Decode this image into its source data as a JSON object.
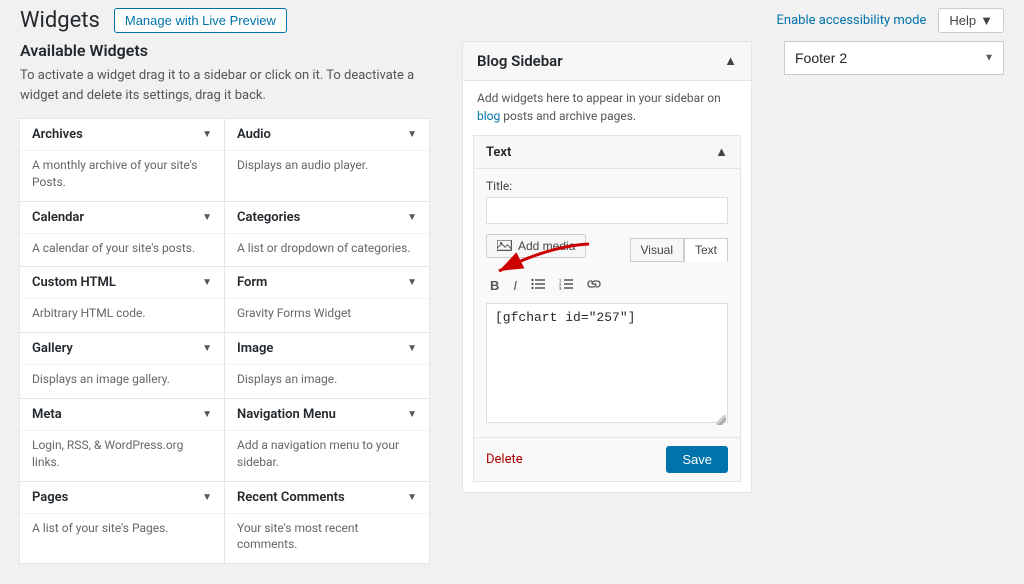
{
  "header": {
    "title": "Widgets",
    "manage_live_preview_label": "Manage with Live Preview",
    "accessibility_link": "Enable accessibility mode",
    "help_button": "Help"
  },
  "available_widgets": {
    "title": "Available Widgets",
    "description": "To activate a widget drag it to a sidebar or click on it. To deactivate a widget and delete its settings, drag it back.",
    "widgets": [
      {
        "name": "Archives",
        "desc": "A monthly archive of your site's Posts."
      },
      {
        "name": "Audio",
        "desc": "Displays an audio player."
      },
      {
        "name": "Calendar",
        "desc": "A calendar of your site's posts."
      },
      {
        "name": "Categories",
        "desc": "A list or dropdown of categories."
      },
      {
        "name": "Custom HTML",
        "desc": "Arbitrary HTML code."
      },
      {
        "name": "Form",
        "desc": "Gravity Forms Widget"
      },
      {
        "name": "Gallery",
        "desc": "Displays an image gallery."
      },
      {
        "name": "Image",
        "desc": "Displays an image."
      },
      {
        "name": "Meta",
        "desc": "Login, RSS, & WordPress.org links."
      },
      {
        "name": "Navigation Menu",
        "desc": "Add a navigation menu to your sidebar."
      },
      {
        "name": "Pages",
        "desc": "A list of your site's Pages."
      },
      {
        "name": "Recent Comments",
        "desc": "Your site's most recent comments."
      }
    ]
  },
  "blog_sidebar": {
    "title": "Blog Sidebar",
    "description": "Add widgets here to appear in your sidebar on blog posts and archive pages.",
    "text_widget": {
      "title": "Text",
      "title_label": "Title:",
      "title_placeholder": "",
      "add_media_label": "Add media",
      "visual_tab": "Visual",
      "text_tab": "Text",
      "content": "[gfchart id=\"257\"]",
      "delete_label": "Delete",
      "save_label": "Save"
    }
  },
  "footer2": {
    "label": "Footer 2"
  }
}
